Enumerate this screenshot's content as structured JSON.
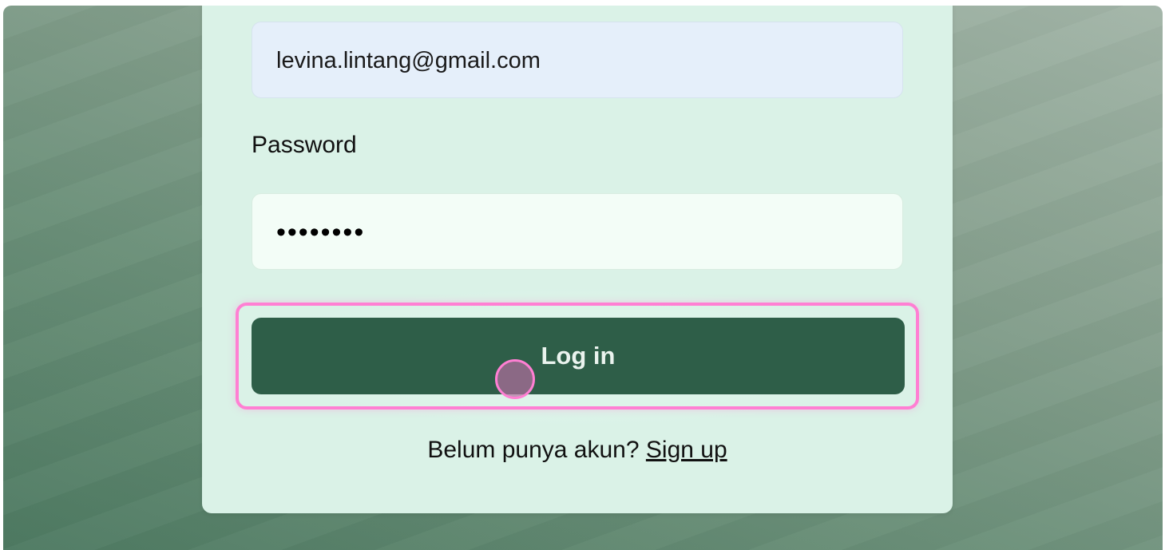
{
  "login_form": {
    "email_value": "levina.lintang@gmail.com",
    "password_label": "Password",
    "password_masked": "••••••••",
    "login_button_label": "Log in",
    "signup_prompt": "Belum punya akun?",
    "signup_link_label": "Sign up"
  },
  "colors": {
    "card_background": "#daf2e7",
    "button_primary": "#2e5e48",
    "highlight": "#ff7fd3",
    "email_field_background": "#e5effa"
  }
}
